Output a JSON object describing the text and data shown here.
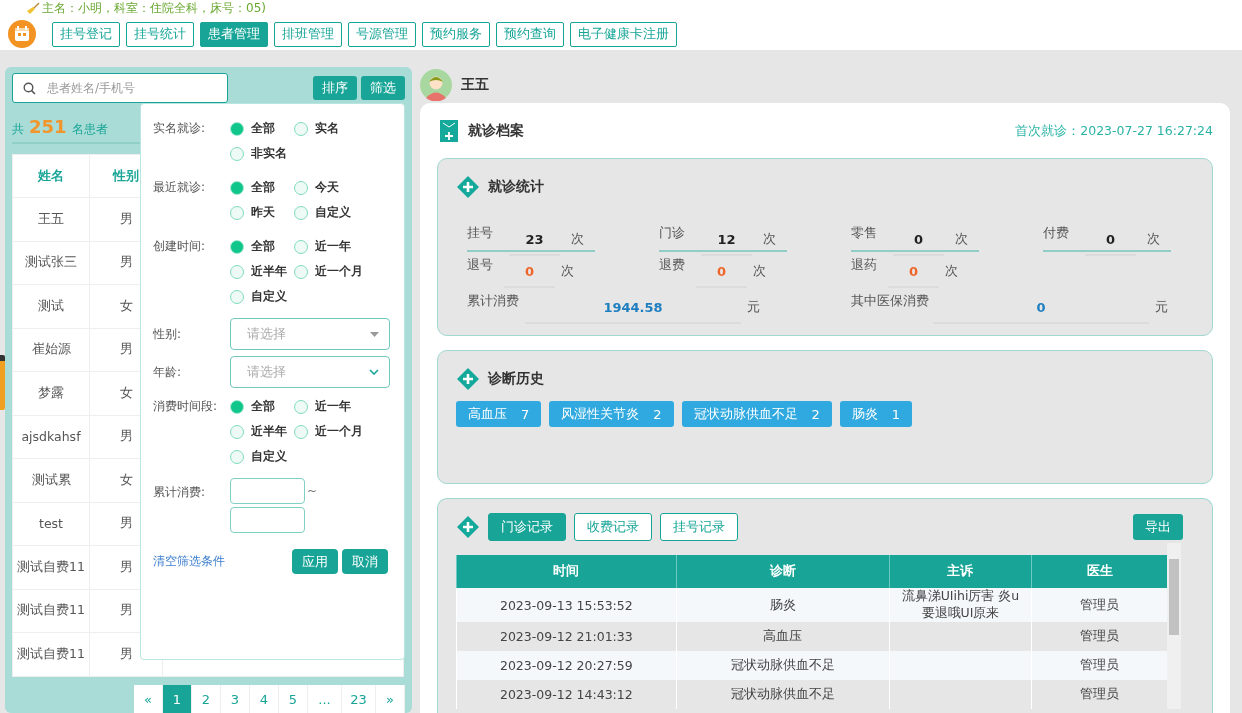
{
  "user_info": "主名：小明，科室：住院全科，床号：05)",
  "nav_tabs": [
    {
      "label": "挂号登记",
      "selected": false
    },
    {
      "label": "挂号统计",
      "selected": false
    },
    {
      "label": "患者管理",
      "selected": true
    },
    {
      "label": "排班管理",
      "selected": false
    },
    {
      "label": "号源管理",
      "selected": false
    },
    {
      "label": "预约服务",
      "selected": false
    },
    {
      "label": "预约查询",
      "selected": false
    },
    {
      "label": "电子健康卡注册",
      "selected": false
    }
  ],
  "patient_list": {
    "search_placeholder": "患者姓名/手机号",
    "buttons": [
      "排序",
      "筛选"
    ],
    "count_prefix": "共",
    "count": "251",
    "count_suffix": "名患者",
    "columns": [
      "姓名",
      "性别"
    ],
    "rows": [
      [
        "王五",
        "男"
      ],
      [
        "测试张三",
        "男"
      ],
      [
        "测试",
        "女"
      ],
      [
        "崔始源",
        "男"
      ],
      [
        "梦露",
        "女"
      ],
      [
        "ajsdkahsf",
        "男"
      ],
      [
        "测试累",
        "女"
      ],
      [
        "test",
        "男"
      ],
      [
        "测试自费11",
        "男"
      ],
      [
        "测试自费11",
        "男"
      ],
      [
        "测试自费11",
        "男"
      ]
    ],
    "pagination": [
      {
        "label": "«",
        "selected": false
      },
      {
        "label": "1",
        "selected": true
      },
      {
        "label": "2",
        "selected": false
      },
      {
        "label": "3",
        "selected": false
      },
      {
        "label": "4",
        "selected": false
      },
      {
        "label": "5",
        "selected": false
      },
      {
        "label": "...",
        "selected": false
      },
      {
        "label": "23",
        "selected": false
      },
      {
        "label": "»",
        "selected": false
      }
    ]
  },
  "filter": {
    "groups": [
      {
        "kind": "radio",
        "label": "实名就诊:",
        "options": [
          {
            "label": "全部",
            "selected": true
          },
          {
            "label": "实名",
            "selected": false
          },
          {
            "label": "非实名",
            "selected": false
          }
        ]
      },
      {
        "kind": "radio",
        "label": "最近就诊:",
        "options": [
          {
            "label": "全部",
            "selected": true
          },
          {
            "label": "今天",
            "selected": false
          },
          {
            "label": "昨天",
            "selected": false
          },
          {
            "label": "自定义",
            "selected": false
          }
        ]
      },
      {
        "kind": "radio",
        "label": "创建时间:",
        "options": [
          {
            "label": "全部",
            "selected": true
          },
          {
            "label": "近一年",
            "selected": false
          },
          {
            "label": "近半年",
            "selected": false
          },
          {
            "label": "近一个月",
            "selected": false
          },
          {
            "label": "自定义",
            "selected": false
          }
        ]
      },
      {
        "kind": "select",
        "label": "性别:",
        "placeholder": "请选择"
      },
      {
        "kind": "dropdown",
        "label": "年龄:",
        "placeholder": "请选择"
      },
      {
        "kind": "radio",
        "label": "消费时间段:",
        "options": [
          {
            "label": "全部",
            "selected": true
          },
          {
            "label": "近一年",
            "selected": false
          },
          {
            "label": "近半年",
            "selected": false
          },
          {
            "label": "近一个月",
            "selected": false
          },
          {
            "label": "自定义",
            "selected": false
          }
        ]
      },
      {
        "kind": "range",
        "label": "累计消费:",
        "separator": "~"
      }
    ],
    "clear_link": "清空筛选条件",
    "buttons": [
      "应用",
      "取消"
    ]
  },
  "patient": {
    "name": "王五"
  },
  "record": {
    "title": "就诊档案",
    "first_visit": "首次就诊：2023-07-27 16:27:24",
    "stats": {
      "title": "就诊统计",
      "items": [
        {
          "label": "挂号",
          "value": "23",
          "unit": "次",
          "kind": "count"
        },
        {
          "label": "门诊",
          "value": "12",
          "unit": "次",
          "kind": "count"
        },
        {
          "label": "零售",
          "value": "0",
          "unit": "次",
          "kind": "count"
        },
        {
          "label": "付费",
          "value": "0",
          "unit": "次",
          "kind": "count"
        },
        {
          "label": "退号",
          "value": "0",
          "unit": "次",
          "kind": "refund"
        },
        {
          "label": "退费",
          "value": "0",
          "unit": "次",
          "kind": "refund"
        },
        {
          "label": "退药",
          "value": "0",
          "unit": "次",
          "kind": "refund"
        },
        {
          "label": "累计消费",
          "value": "1944.58",
          "unit": "元",
          "kind": "money"
        },
        {
          "label": "其中医保消费",
          "value": "0",
          "unit": "元",
          "kind": "money"
        }
      ]
    },
    "diagnoses": {
      "title": "诊断历史",
      "tags": [
        {
          "label": "高血压",
          "count": "7"
        },
        {
          "label": "风湿性关节炎",
          "count": "2"
        },
        {
          "label": "冠状动脉供血不足",
          "count": "2"
        },
        {
          "label": "肠炎",
          "count": "1"
        }
      ]
    },
    "records": {
      "tabs": [
        {
          "label": "门诊记录",
          "selected": true
        },
        {
          "label": "收费记录",
          "selected": false
        },
        {
          "label": "挂号记录",
          "selected": false
        }
      ],
      "export": "导出",
      "columns": [
        "时间",
        "诊断",
        "主诉",
        "医生"
      ],
      "rows": [
        [
          "2023-09-13 15:53:52",
          "肠炎",
          "流鼻涕UIihi厉害 炎u要退哦UI原来",
          "管理员"
        ],
        [
          "2023-09-12 21:01:33",
          "高血压",
          "",
          "管理员"
        ],
        [
          "2023-09-12 20:27:59",
          "冠状动脉供血不足",
          "",
          "管理员"
        ],
        [
          "2023-09-12 14:43:12",
          "冠状动脉供血不足",
          "",
          "管理员"
        ]
      ]
    }
  }
}
